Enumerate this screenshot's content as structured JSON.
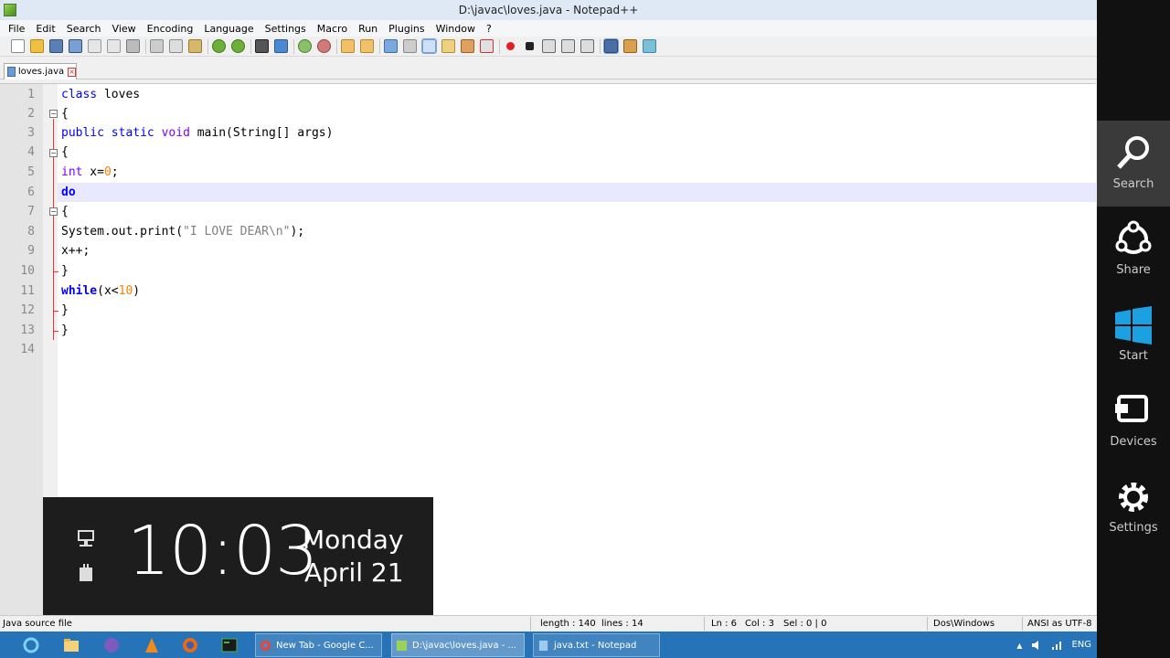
{
  "window": {
    "title": "D:\\javac\\loves.java - Notepad++"
  },
  "menu": [
    "File",
    "Edit",
    "Search",
    "View",
    "Encoding",
    "Language",
    "Settings",
    "Macro",
    "Run",
    "Plugins",
    "Window",
    "?"
  ],
  "tab": {
    "label": "loves.java"
  },
  "editor": {
    "current_line": 6,
    "line_numbers": [
      "1",
      "2",
      "3",
      "4",
      "5",
      "6",
      "7",
      "8",
      "9",
      "10",
      "11",
      "12",
      "13",
      "14"
    ]
  },
  "code": {
    "l1_kw": "class",
    "l1_rest": " loves",
    "l2": "{",
    "l3_kw1": "public",
    "l3_sp1": " ",
    "l3_kw2": "static",
    "l3_sp2": " ",
    "l3_kw3": "void",
    "l3_rest": " main(String[] args)",
    "l4": "{",
    "l5_kw": "int",
    "l5_a": " x=",
    "l5_num": "0",
    "l5_b": ";",
    "l6_kw": "do",
    "l7": "{",
    "l8_a": "System.out.print(",
    "l8_str": "\"I LOVE DEAR\\n\"",
    "l8_b": ");",
    "l9": "x++;",
    "l10": "}",
    "l11_kw": "while",
    "l11_a": "(x<",
    "l11_num": "10",
    "l11_b": ")",
    "l12": "}",
    "l13": "}"
  },
  "statusbar": {
    "filetype": "Java source file",
    "length": "length : 140",
    "lines": "lines : 14",
    "ln": "Ln : 6",
    "col": "Col : 3",
    "sel": "Sel : 0 | 0",
    "eol": "Dos\\Windows",
    "encoding": "ANSI as UTF-8"
  },
  "taskbar": {
    "tasks": [
      "New Tab - Google C...",
      "D:\\javac\\loves.java - ...",
      "java.txt - Notepad"
    ],
    "tray_lang": "ENG"
  },
  "charms": {
    "search": "Search",
    "share": "Share",
    "start": "Start",
    "devices": "Devices",
    "settings": "Settings"
  },
  "clock": {
    "time": "10:03",
    "day": "Monday",
    "date": "April 21"
  },
  "colors": {
    "keyword": "#0000ff",
    "type_keyword": "#8000ff",
    "number": "#ff8000",
    "string": "#808080",
    "taskbar": "#2773b8",
    "charms_bg": "#111111"
  }
}
